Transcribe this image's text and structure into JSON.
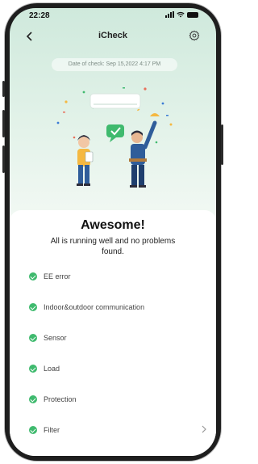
{
  "status_bar": {
    "time": "22:28"
  },
  "header": {
    "title": "iCheck",
    "back_icon": "chevron-left-icon",
    "settings_icon": "gear-icon"
  },
  "check_date": "Date of check: Sep 15,2022 4:17 PM",
  "result": {
    "headline": "Awesome!",
    "message": "All is running well and no problems found."
  },
  "checklist": [
    {
      "label": "EE error"
    },
    {
      "label": "Indoor&outdoor communication"
    },
    {
      "label": "Sensor"
    },
    {
      "label": "Load"
    },
    {
      "label": "Protection"
    },
    {
      "label": "Filter"
    }
  ],
  "colors": {
    "accent": "#3fba6e",
    "background_top": "#cfe9dc"
  }
}
